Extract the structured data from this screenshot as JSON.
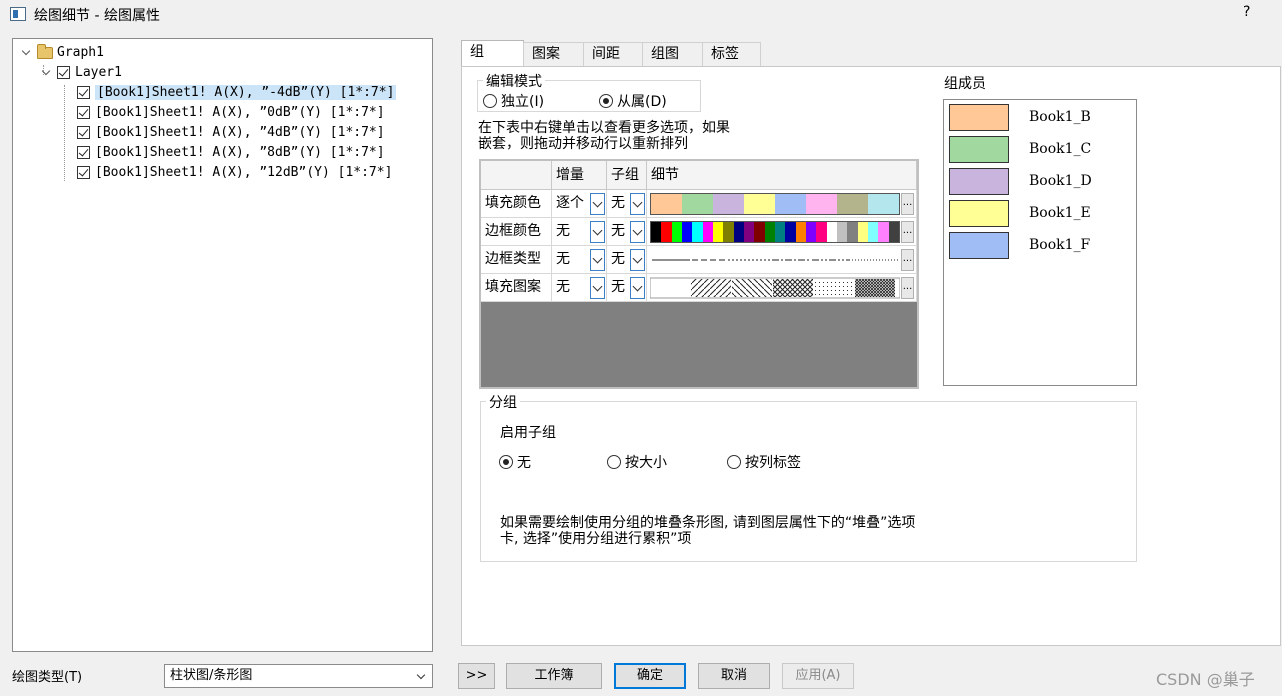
{
  "window": {
    "title": "绘图细节 - 绘图属性",
    "help": "?"
  },
  "tree": {
    "root": "Graph1",
    "layer": "Layer1",
    "plots": [
      "[Book1]Sheet1! A(X), ”-4dB”(Y) [1*:7*]",
      "[Book1]Sheet1! A(X), ”0dB”(Y) [1*:7*]",
      "[Book1]Sheet1! A(X), ”4dB”(Y) [1*:7*]",
      "[Book1]Sheet1! A(X), ”8dB”(Y) [1*:7*]",
      "[Book1]Sheet1! A(X), ”12dB”(Y) [1*:7*]"
    ]
  },
  "tabs": [
    "组",
    "图案",
    "间距",
    "组图",
    "标签"
  ],
  "edit_mode": {
    "title": "编辑模式",
    "independent": "独立(I)",
    "dependent": "从属(D)",
    "selected": "dependent"
  },
  "hint": "在下表中右键单击以查看更多选项，如果嵌套，则拖动并移动行以重新排列",
  "hint_lines": [
    "在下表中右键单击以查看更多选项，如果",
    "嵌套，则拖动并移动行以重新排列"
  ],
  "grid": {
    "headers": [
      "增量",
      "子组",
      "细节"
    ],
    "rows": [
      {
        "label": "填充颜色",
        "increment": "逐个",
        "subgroup": "无",
        "kind": "fill-colors"
      },
      {
        "label": "边框颜色",
        "increment": "无",
        "subgroup": "无",
        "kind": "border-colors"
      },
      {
        "label": "边框类型",
        "increment": "无",
        "subgroup": "无",
        "kind": "line-types"
      },
      {
        "label": "填充图案",
        "increment": "无",
        "subgroup": "无",
        "kind": "patterns"
      }
    ],
    "ellipsis": "...",
    "fill_colors": [
      "#ffc896",
      "#a0d8a0",
      "#c8b4dc",
      "#ffff96",
      "#a0bef5",
      "#ffb4f0",
      "#b4b48c",
      "#b4e6ee"
    ],
    "border_colors": [
      "#000000",
      "#ff0000",
      "#00ff00",
      "#0000ff",
      "#00ffff",
      "#ff00ff",
      "#ffff00",
      "#808000",
      "#000080",
      "#800080",
      "#800000",
      "#008000",
      "#008080",
      "#0000a0",
      "#ff8000",
      "#8000ff",
      "#ff0080",
      "#ffffff",
      "#c0c0c0",
      "#808080",
      "#ffff80",
      "#80ffff",
      "#ff80ff",
      "#404040"
    ]
  },
  "members": {
    "title": "组成员",
    "items": [
      {
        "name": "Book1_B",
        "color": "#ffc896"
      },
      {
        "name": "Book1_C",
        "color": "#a0d8a0"
      },
      {
        "name": "Book1_D",
        "color": "#c8b4dc"
      },
      {
        "name": "Book1_E",
        "color": "#ffff96"
      },
      {
        "name": "Book1_F",
        "color": "#a0bef5"
      }
    ]
  },
  "grouping": {
    "title": "分组",
    "subgroup_label": "启用子组",
    "options": [
      "无",
      "按大小",
      "按列标签"
    ],
    "selected": 0,
    "note_lines": [
      "如果需要绘制使用分组的堆叠条形图, 请到图层属性下的“堆叠”选项",
      "卡, 选择”使用分组进行累积”项"
    ]
  },
  "footer": {
    "plot_type_label": "绘图类型(T)",
    "plot_type_value": "柱状图/条形图",
    "expand": ">>",
    "workbook": "工作簿",
    "ok": "确定",
    "cancel": "取消",
    "apply": "应用(A)"
  },
  "watermark": "CSDN @巢子"
}
